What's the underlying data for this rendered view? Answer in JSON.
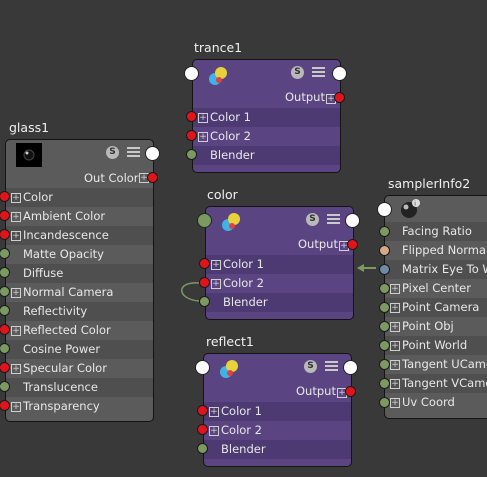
{
  "nodes": {
    "trance": {
      "title": "trance1",
      "output_label": "Output",
      "rows": [
        "Color 1",
        "Color 2",
        "Blender"
      ]
    },
    "color": {
      "title": "color",
      "output_label": "Output",
      "rows": [
        "Color 1",
        "Color 2",
        "Blender"
      ]
    },
    "reflect": {
      "title": "reflect1",
      "output_label": "Output",
      "rows": [
        "Color 1",
        "Color 2",
        "Blender"
      ]
    },
    "glass": {
      "title": "glass1",
      "output_label": "Out Color",
      "rows": [
        "Color",
        "Ambient Color",
        "Incandescence",
        "Matte Opacity",
        "Diffuse",
        "Normal Camera",
        "Reflectivity",
        "Reflected Color",
        "Cosine Power",
        "Specular Color",
        "Translucence",
        "Transparency"
      ]
    },
    "sampler": {
      "title": "samplerInfo2",
      "rows": [
        "Facing Ratio",
        "Flipped Normal",
        "Matrix Eye To W",
        "Pixel Center",
        "Point Camera",
        "Point Obj",
        "Point World",
        "Tangent UCamer",
        "Tangent VCamer",
        "Uv Coord"
      ]
    }
  },
  "icons": {
    "shader_swatch": "color-blend-icon",
    "glass_swatch": "sphere-icon",
    "sampler_swatch": "sphere-info-icon",
    "solo_button": "S",
    "menu_button": "list-icon"
  },
  "colors": {
    "background": "#393939",
    "utility_node": "#5a4582",
    "material_node": "#5b5b5b",
    "port_red": "#e0141a",
    "port_green": "#7a9a62",
    "connection": "#7a9a62"
  }
}
